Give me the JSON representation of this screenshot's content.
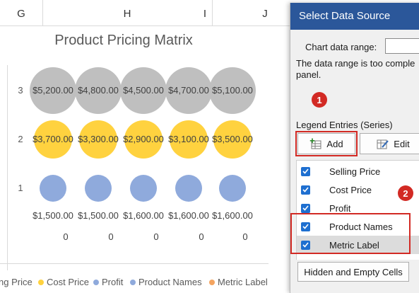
{
  "columns": [
    "G",
    "H",
    "I",
    "J"
  ],
  "chart": {
    "title": "Product Pricing Matrix",
    "y_ticks": [
      "3",
      "2",
      "1"
    ],
    "legend": [
      {
        "label": "ng Price",
        "color": "#bfbfbf"
      },
      {
        "label": "Cost Price",
        "color": "#ffd23f"
      },
      {
        "label": "Profit",
        "color": "#8faadc"
      },
      {
        "label": "Product Names",
        "color": "#8faadc"
      },
      {
        "label": "Metric Label",
        "color": "#f4a460"
      }
    ],
    "colors": {
      "row3": "#bfbfbf",
      "row2": "#ffd23f",
      "row1": "#8faadc"
    }
  },
  "chart_data": {
    "type": "scatter",
    "title": "Product Pricing Matrix",
    "y_ticks": [
      1,
      2,
      3
    ],
    "series": [
      {
        "name": "Selling Price",
        "y": 3,
        "labels": [
          "$5,200.00",
          "$4,800.00",
          "$4,500.00",
          "$4,700.00",
          "$5,100.00"
        ]
      },
      {
        "name": "Cost Price",
        "y": 2,
        "labels": [
          "$3,700.00",
          "$3,300.00",
          "$2,900.00",
          "$3,100.00",
          "$3,500.00"
        ]
      },
      {
        "name": "Profit",
        "y": 1,
        "labels": [
          "$1,500.00",
          "$1,500.00",
          "$1,600.00",
          "$1,600.00",
          "$1,600.00"
        ]
      }
    ],
    "zero_labels": [
      "0",
      "0",
      "0",
      "0",
      "0"
    ]
  },
  "dialog": {
    "title": "Select Data Source",
    "chart_range_label": "Chart data range:",
    "chart_range_value": "",
    "message": "The data range is too complex to be displayed. If a new range is selected, it will replace all of the series in the Series panel.",
    "message_line1": "The data range is too comple",
    "message_line2": "panel.",
    "legend_entries_label": "Legend Entries (Series)",
    "add_label": "Add",
    "edit_label": "Edit",
    "series": [
      "Selling Price",
      "Cost Price",
      "Profit",
      "Product Names",
      "Metric Label"
    ],
    "hidden_cells_label": "Hidden and Empty Cells",
    "badge1": "1",
    "badge2": "2"
  }
}
